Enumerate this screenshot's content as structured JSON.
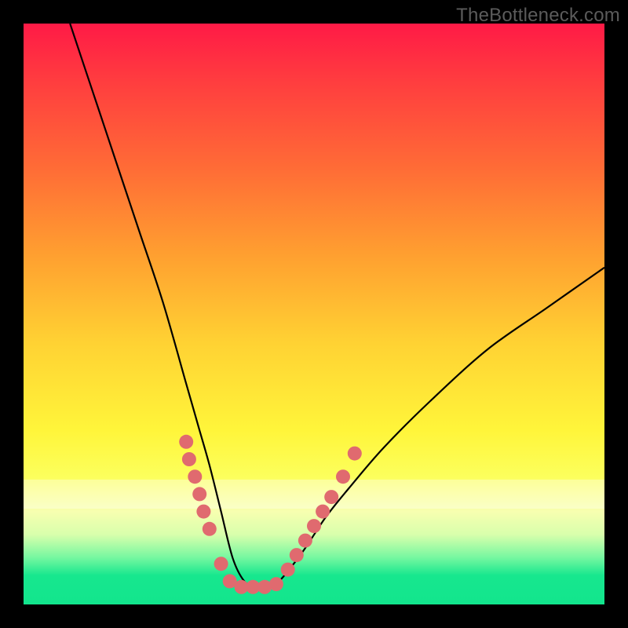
{
  "watermark": {
    "text": "TheBottleneck.com"
  },
  "chart_data": {
    "type": "line",
    "title": "",
    "xlabel": "",
    "ylabel": "",
    "xlim": [
      0,
      100
    ],
    "ylim": [
      0,
      100
    ],
    "grid": false,
    "curve_note": "Steep asymmetric V-shaped bottleneck curve. Left arm descends from near 100% at x≈8 to ~3% at x≈36; flat trough ~3% between x≈36 and x≈43; right arm rises to ~58% at x≈100. Values eyeballed from pixel positions.",
    "series": [
      {
        "name": "bottleneck-curve",
        "x": [
          8,
          12,
          16,
          20,
          24,
          28,
          30,
          32,
          34,
          36,
          38,
          40,
          42,
          44,
          48,
          52,
          56,
          62,
          70,
          80,
          90,
          100
        ],
        "y": [
          100,
          88,
          76,
          64,
          52,
          38,
          31,
          24,
          16,
          8,
          4,
          3,
          3,
          4,
          9,
          15,
          20,
          27,
          35,
          44,
          51,
          58
        ]
      }
    ],
    "data_markers_note": "Salmon circular markers clustered on lower portions of both arms and across trough; approximate positions below.",
    "data_markers": [
      {
        "x": 28,
        "y": 28
      },
      {
        "x": 28.5,
        "y": 25
      },
      {
        "x": 29.5,
        "y": 22
      },
      {
        "x": 30.3,
        "y": 19
      },
      {
        "x": 31,
        "y": 16
      },
      {
        "x": 32,
        "y": 13
      },
      {
        "x": 34,
        "y": 7
      },
      {
        "x": 35.5,
        "y": 4
      },
      {
        "x": 37.5,
        "y": 3
      },
      {
        "x": 39.5,
        "y": 3
      },
      {
        "x": 41.5,
        "y": 3
      },
      {
        "x": 43.5,
        "y": 3.5
      },
      {
        "x": 45.5,
        "y": 6
      },
      {
        "x": 47,
        "y": 8.5
      },
      {
        "x": 48.5,
        "y": 11
      },
      {
        "x": 50,
        "y": 13.5
      },
      {
        "x": 51.5,
        "y": 16
      },
      {
        "x": 53,
        "y": 18.5
      },
      {
        "x": 55,
        "y": 22
      },
      {
        "x": 57,
        "y": 26
      }
    ],
    "gradient_colors": {
      "top": "#ff1a46",
      "mid": "#fff53a",
      "bottom": "#12e58d"
    },
    "marker_color": "#e06a6f",
    "curve_color": "#000000"
  }
}
